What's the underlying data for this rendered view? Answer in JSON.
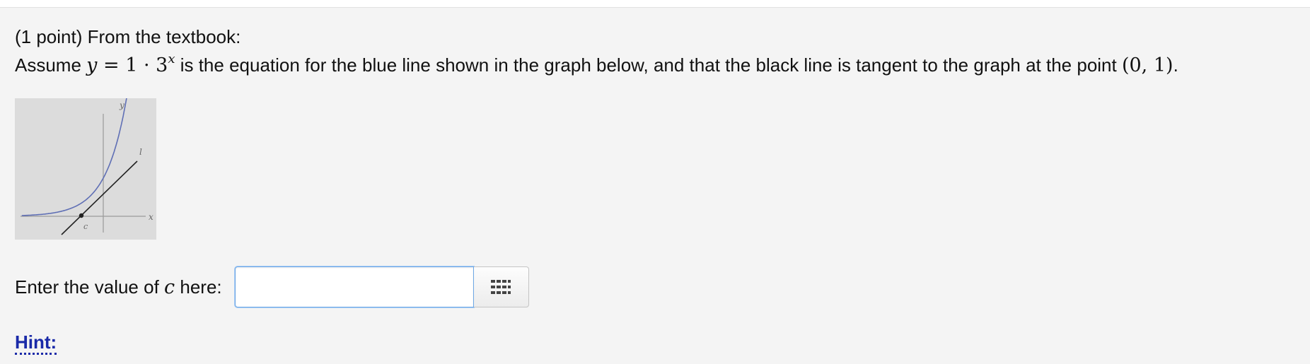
{
  "problem": {
    "points_label": "(1 point) From the textbook:",
    "statement_before": "Assume ",
    "eq_y": "y",
    "eq_eq": " = 1 · 3",
    "eq_exp": "x",
    "statement_middle": " is the equation for the blue line shown in the graph below, and that the black line is tangent to the graph at the point ",
    "point": "(0, 1)",
    "statement_end": "."
  },
  "graph": {
    "y_axis_label": "y",
    "x_axis_label": "x",
    "tangent_label": "l",
    "point_label": "c",
    "colors": {
      "background": "#dcdcdc",
      "curve": "#5f6fb5",
      "tangent": "#222222",
      "axes": "#9a9a9a"
    }
  },
  "answer": {
    "prompt_before": "Enter the value of ",
    "prompt_var": "c",
    "prompt_after": " here:",
    "value": "",
    "keypad_icon": "keypad-grid-icon"
  },
  "hint": {
    "label": "Hint:"
  }
}
